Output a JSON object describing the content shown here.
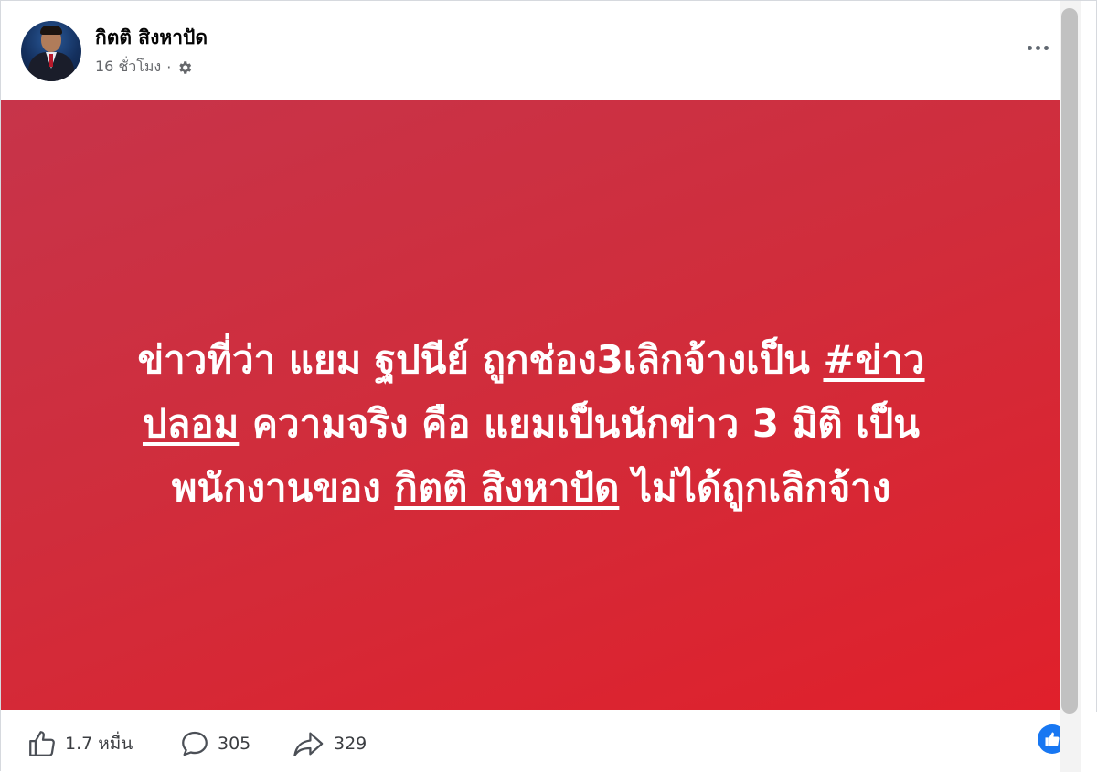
{
  "post": {
    "author": "กิตติ สิงหาปัด",
    "time": "16 ชั่วโมง",
    "separator": "·",
    "audience_icon": "gear-icon",
    "more_icon": "more-options-icon"
  },
  "image_text": {
    "line1_a": "ข่าวที่ว่า แยม ฐปนีย์ ถูกช่อง3เลิกจ้างเป็น ",
    "line1_u": "#ข่าว",
    "line2_u": "ปลอม",
    "line2_b": " ความจริง คือ แยมเป็นนักข่าว 3 มิติ เป็น",
    "line3_a": "พนักงานของ ",
    "line3_u": "กิตติ สิงหาปัด",
    "line3_b": " ไม่ได้ถูกเลิกจ้าง"
  },
  "stats": {
    "likes": "1.7 หมื่น",
    "comments": "305",
    "shares": "329"
  },
  "colors": {
    "banner_start": "#c7344a",
    "banner_end": "#e0202b",
    "reaction_blue": "#1877f2"
  }
}
